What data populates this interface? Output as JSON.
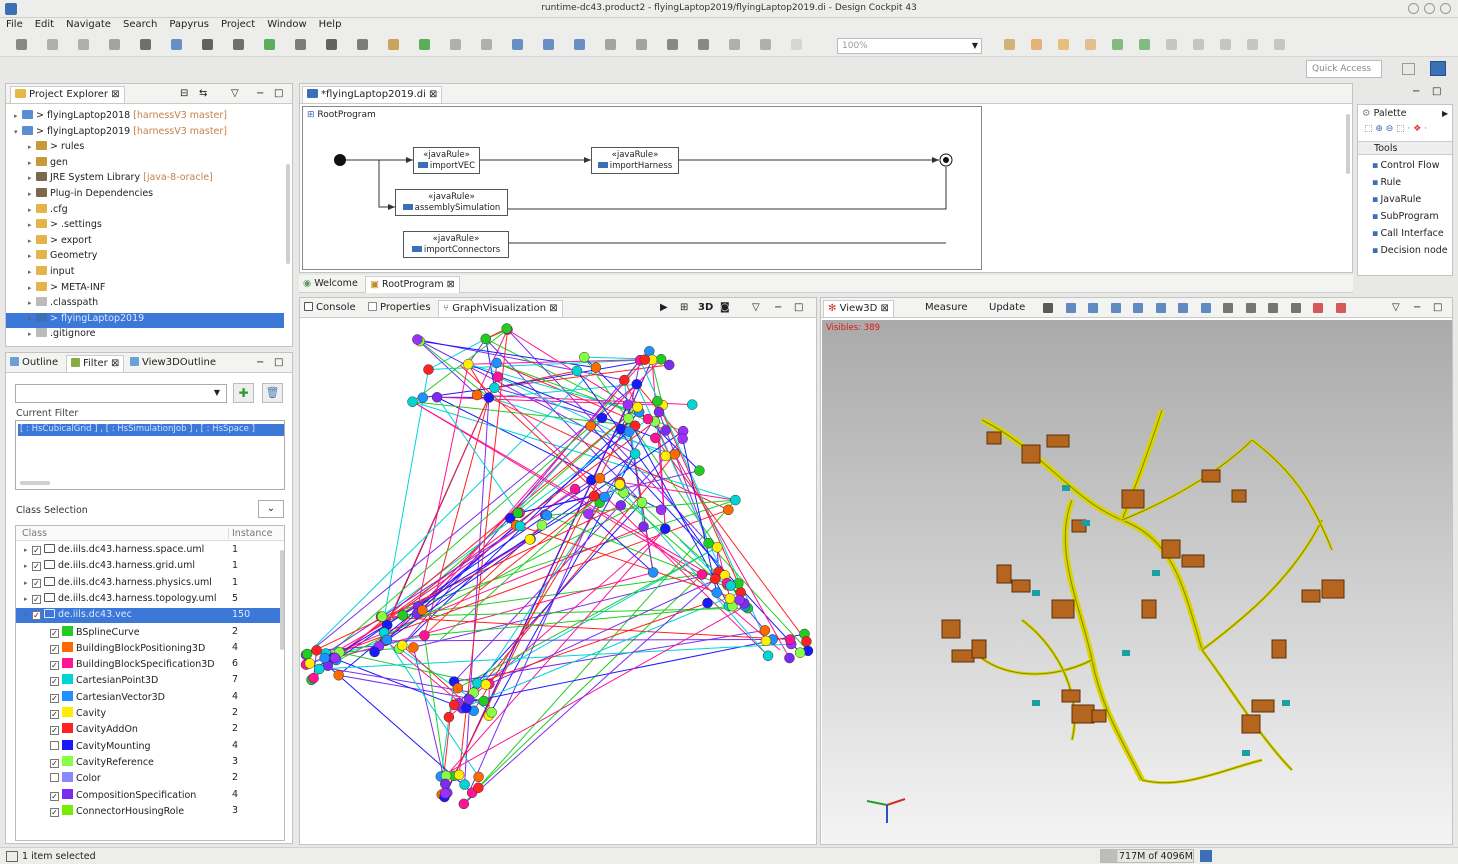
{
  "window": {
    "title": "runtime-dc43.product2 - flyingLaptop2019/flyingLaptop2019.di - Design Cockpit 43"
  },
  "menu": [
    "File",
    "Edit",
    "Navigate",
    "Search",
    "Papyrus",
    "Project",
    "Window",
    "Help"
  ],
  "toolbar": {
    "zoom": "100%",
    "quick_access": "Quick Access"
  },
  "project_explorer": {
    "tab": "Project Explorer",
    "items": [
      {
        "label": "> flyingLaptop2018",
        "suffix": " [harnessV3 master]",
        "depth": 0,
        "open": false,
        "icon": "project-icon"
      },
      {
        "label": "> flyingLaptop2019",
        "suffix": " [harnessV3 master]",
        "depth": 0,
        "open": true,
        "icon": "project-icon"
      },
      {
        "label": "> rules",
        "suffix": "",
        "depth": 1,
        "open": false,
        "icon": "package-icon"
      },
      {
        "label": "gen",
        "suffix": "",
        "depth": 1,
        "open": false,
        "icon": "package-icon"
      },
      {
        "label": "JRE System Library",
        "suffix": " [java-8-oracle]",
        "depth": 1,
        "open": false,
        "icon": "library-icon"
      },
      {
        "label": "Plug-in Dependencies",
        "suffix": "",
        "depth": 1,
        "open": false,
        "icon": "library-icon"
      },
      {
        "label": ".cfg",
        "suffix": "",
        "depth": 1,
        "open": false,
        "icon": "folder-icon"
      },
      {
        "label": "> .settings",
        "suffix": "",
        "depth": 1,
        "open": false,
        "icon": "folder-icon"
      },
      {
        "label": "> export",
        "suffix": "",
        "depth": 1,
        "open": false,
        "icon": "folder-icon"
      },
      {
        "label": "Geometry",
        "suffix": "",
        "depth": 1,
        "open": false,
        "icon": "folder-icon"
      },
      {
        "label": "input",
        "suffix": "",
        "depth": 1,
        "open": false,
        "icon": "folder-icon"
      },
      {
        "label": "> META-INF",
        "suffix": "",
        "depth": 1,
        "open": false,
        "icon": "folder-icon"
      },
      {
        "label": ".classpath",
        "suffix": "",
        "depth": 1,
        "open": false,
        "icon": "file-icon"
      },
      {
        "label": "> flyingLaptop2019",
        "suffix": "",
        "depth": 1,
        "open": false,
        "icon": "model-icon",
        "selected": true
      },
      {
        "label": ".gitignore",
        "suffix": "",
        "depth": 1,
        "open": false,
        "icon": "file-icon"
      }
    ]
  },
  "outline": {
    "tabs": [
      "Outline",
      "Filter",
      "View3DOutline"
    ],
    "current_filter_label": "Current Filter",
    "current_filter_value": "[ : HsCubicalGrid ] , [ : HsSimulationJob ] , [ : HsSpace ]",
    "class_selection_label": "Class Selection",
    "col_class": "Class",
    "col_instance": "Instance",
    "rows": [
      {
        "label": "de.iils.dc43.harness.space.uml",
        "count": "1",
        "type": "package",
        "checked": true,
        "color": ""
      },
      {
        "label": "de.iils.dc43.harness.grid.uml",
        "count": "1",
        "type": "package",
        "checked": true,
        "color": ""
      },
      {
        "label": "de.iils.dc43.harness.physics.uml",
        "count": "1",
        "type": "package",
        "checked": true,
        "color": ""
      },
      {
        "label": "de.iils.dc43.harness.topology.uml",
        "count": "5",
        "type": "package",
        "checked": true,
        "color": ""
      },
      {
        "label": "de.iils.dc43.vec",
        "count": "150",
        "type": "package-open",
        "checked": true,
        "color": "",
        "selected": true
      },
      {
        "label": "BSplineCurve",
        "count": "2",
        "type": "class",
        "checked": true,
        "color": "#22cc22"
      },
      {
        "label": "BuildingBlockPositioning3D",
        "count": "4",
        "type": "class",
        "checked": true,
        "color": "#ff6a00"
      },
      {
        "label": "BuildingBlockSpecification3D",
        "count": "6",
        "type": "class",
        "checked": true,
        "color": "#ff1493"
      },
      {
        "label": "CartesianPoint3D",
        "count": "7",
        "type": "class",
        "checked": true,
        "color": "#00d5d5"
      },
      {
        "label": "CartesianVector3D",
        "count": "4",
        "type": "class",
        "checked": true,
        "color": "#1e90ff"
      },
      {
        "label": "Cavity",
        "count": "2",
        "type": "class",
        "checked": true,
        "color": "#ffee00"
      },
      {
        "label": "CavityAddOn",
        "count": "2",
        "type": "class",
        "checked": true,
        "color": "#ff2222"
      },
      {
        "label": "CavityMounting",
        "count": "4",
        "type": "class",
        "checked": false,
        "color": "#1a1aff"
      },
      {
        "label": "CavityReference",
        "count": "3",
        "type": "class",
        "checked": true,
        "color": "#88ff44"
      },
      {
        "label": "Color",
        "count": "2",
        "type": "class",
        "checked": false,
        "color": "#8888ff"
      },
      {
        "label": "CompositionSpecification",
        "count": "4",
        "type": "class",
        "checked": true,
        "color": "#7b2cf0"
      },
      {
        "label": "ConnectorHousingRole",
        "count": "3",
        "type": "class",
        "checked": true,
        "color": "#77ee00"
      }
    ]
  },
  "diagram": {
    "tab": "*flyingLaptop2019.di",
    "root": "RootProgram",
    "nodes": [
      {
        "stereo": "«javaRule»",
        "name": "importVEC"
      },
      {
        "stereo": "«javaRule»",
        "name": "importHarness"
      },
      {
        "stereo": "«javaRule»",
        "name": "assemblySimulation"
      },
      {
        "stereo": "«javaRule»",
        "name": "importConnectors"
      }
    ],
    "subtabs": [
      "Welcome",
      "RootProgram"
    ]
  },
  "palette": {
    "title": "Palette",
    "section": "Tools",
    "items": [
      "Control Flow",
      "Rule",
      "JavaRule",
      "SubProgram",
      "Call Interface",
      "Decision node"
    ]
  },
  "bottom_tabs": {
    "console": "Console",
    "properties": "Properties",
    "graph": "GraphVisualization",
    "mode": "3D"
  },
  "view3d": {
    "tab": "View3D",
    "measure": "Measure",
    "update": "Update",
    "visible_label": "Visibles: 389"
  },
  "status": {
    "left": "1 item selected",
    "memory": "717M of 4096M"
  }
}
